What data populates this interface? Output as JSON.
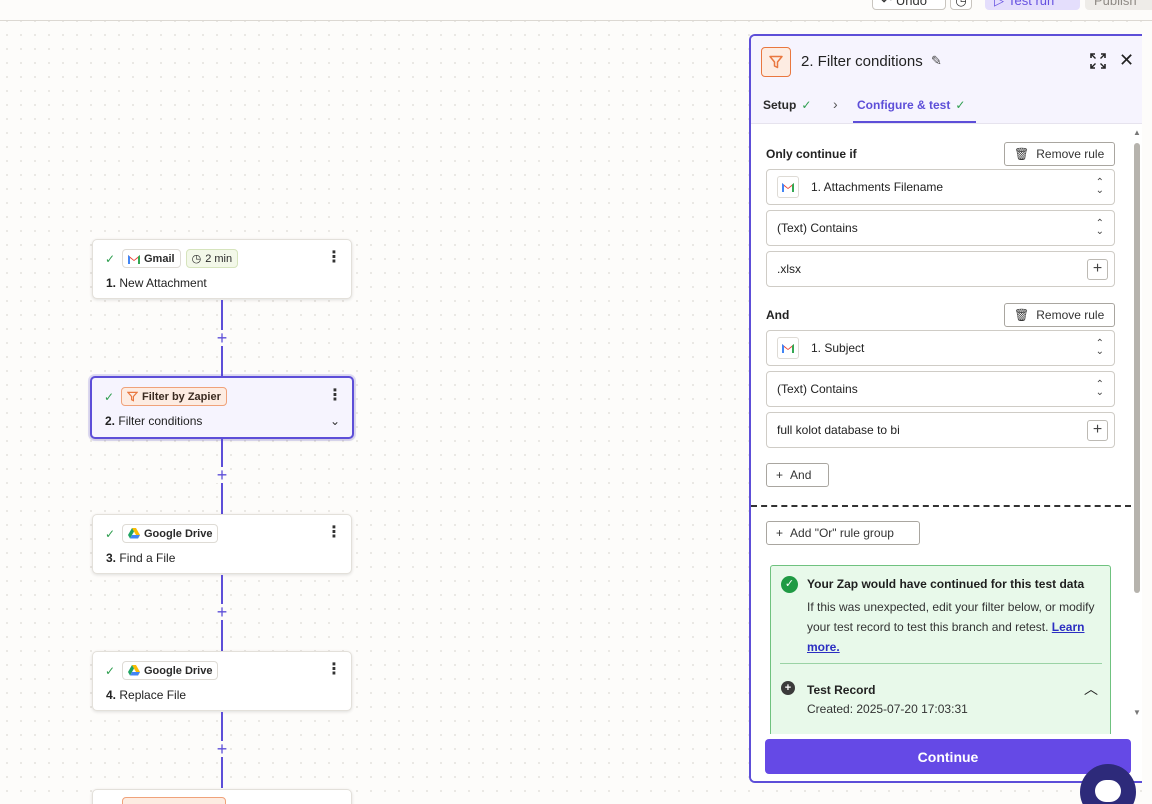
{
  "topbar": {
    "undo_label": "Undo",
    "test_run_label": "Test run",
    "publish_label": "Publish"
  },
  "nodes": [
    {
      "app": "Gmail",
      "time": "2 min",
      "step": "1.",
      "title": "New Attachment"
    },
    {
      "app": "Filter by Zapier",
      "step": "2.",
      "title": "Filter conditions"
    },
    {
      "app": "Google Drive",
      "step": "3.",
      "title": "Find a File"
    },
    {
      "app": "Google Drive",
      "step": "4.",
      "title": "Replace File"
    }
  ],
  "panel": {
    "title": "2. Filter conditions",
    "tabs": [
      {
        "label": "Setup"
      },
      {
        "label": "Configure & test"
      }
    ],
    "rules": {
      "only_continue_if": "Only continue if",
      "remove_rule": "Remove rule",
      "rule1": {
        "field": "1. Attachments Filename",
        "condition": "(Text) Contains",
        "value": ".xlsx"
      },
      "and_label": "And",
      "rule2": {
        "field": "1. Subject",
        "condition": "(Text) Contains",
        "value": "full kolot database to bi"
      },
      "add_and": "And",
      "add_or_group": "Add \"Or\" rule group"
    },
    "result": {
      "title": "Your Zap would have continued for this test data",
      "text": "If this was unexpected, edit your filter below, or modify your test record to test this branch and retest.",
      "learn_more": "Learn more.",
      "record_title": "Test Record",
      "record_created": "Created: 2025-07-20 17:03:31"
    },
    "continue_label": "Continue"
  },
  "colors": {
    "accent": "#5d4ed8",
    "continue_bg": "#6549e6",
    "success_bg": "#e8f9ea",
    "filter_orange": "#e9773f"
  }
}
